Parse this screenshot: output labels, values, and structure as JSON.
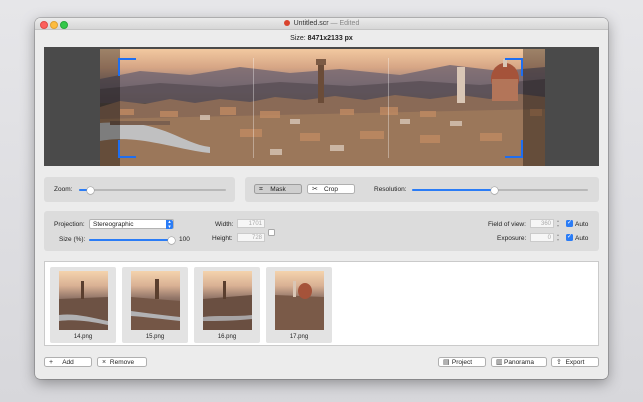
{
  "window": {
    "title": "Untitled.scr",
    "separator": "—",
    "status": "Edited",
    "size_label": "Size:",
    "size_value": "8471x2133 px"
  },
  "toolbar": {
    "zoom_label": "Zoom:",
    "zoom_value": 0.08,
    "mask_label": "Mask",
    "crop_label": "Crop",
    "resolution_label": "Resolution:",
    "resolution_value": 0.47
  },
  "settings": {
    "projection_label": "Projection:",
    "projection_value": "Stereographic",
    "size_label": "Size (%):",
    "size_value": "100",
    "size_slider": 1.0,
    "width_label": "Width:",
    "width_value": "1701",
    "height_label": "Height:",
    "height_value": "728",
    "fov_label": "Field of view:",
    "fov_value": "360",
    "fov_auto_label": "Auto",
    "exposure_label": "Exposure:",
    "exposure_value": "0",
    "exposure_auto_label": "Auto"
  },
  "images": [
    {
      "name": "14.png"
    },
    {
      "name": "15.png"
    },
    {
      "name": "16.png"
    },
    {
      "name": "17.png"
    }
  ],
  "bottom_bar": {
    "add_label": "Add",
    "remove_label": "Remove",
    "project_label": "Project",
    "panorama_label": "Panorama",
    "export_label": "Export"
  },
  "colors": {
    "accent": "#2a7cf6",
    "crop_frame": "#1e6ef0"
  },
  "icons": {
    "crop": "crop-icon",
    "scissors": "scissors-icon",
    "plus": "plus-icon",
    "cross": "cross-icon",
    "project": "project-icon",
    "panorama": "panorama-icon",
    "export": "export-icon"
  }
}
